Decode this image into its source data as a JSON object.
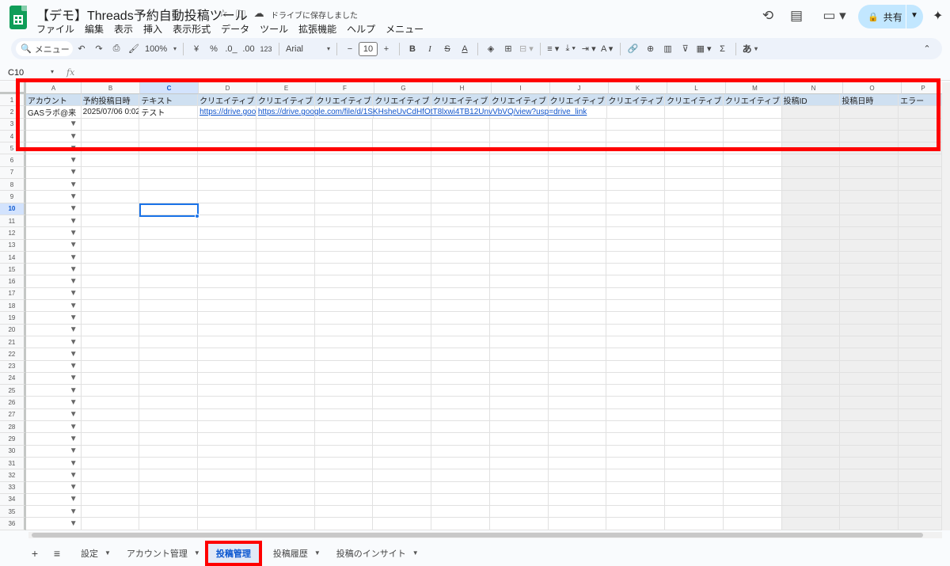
{
  "doc": {
    "title": "【デモ】Threads予約自動投稿ツール",
    "save_status": "ドライブに保存しました",
    "menu": [
      "ファイル",
      "編集",
      "表示",
      "挿入",
      "表示形式",
      "データ",
      "ツール",
      "拡張機能",
      "ヘルプ",
      "メニュー"
    ],
    "share_label": "共有"
  },
  "toolbar": {
    "search_label": "メニュー",
    "zoom": "100%",
    "currency": "¥",
    "percent": "%",
    "dec_decrease": ".0_",
    "dec_increase": ".00",
    "number_format": "123",
    "font": "Arial",
    "font_size": "10",
    "input_mode": "あ"
  },
  "formula_bar": {
    "cell_ref": "C10",
    "fx": "fx"
  },
  "grid": {
    "columns": [
      "A",
      "B",
      "C",
      "D",
      "E",
      "F",
      "G",
      "H",
      "I",
      "J",
      "K",
      "L",
      "M",
      "N",
      "O",
      "P"
    ],
    "headers": [
      "アカウント",
      "予約投稿日時",
      "テキスト",
      "クリエイティブ",
      "クリエイティブ",
      "クリエイティブ",
      "クリエイティブ",
      "クリエイティブ",
      "クリエイティブ",
      "クリエイティブ",
      "クリエイティブ",
      "クリエイティブ",
      "クリエイティブ",
      "投稿ID",
      "投稿日時",
      "エラー"
    ],
    "row2": {
      "account": "GASラボ@来",
      "datetime": "2025/07/06 0:02",
      "text": "テスト",
      "d_link": "https://drive.goog",
      "e_link": "https://drive.google.com/file/d/1SKHsheUvCdHfOtT8lxwi4TB12UnvVbVQ/view?usp=drive_link"
    },
    "row_count": 36,
    "selected_row": 10,
    "selected_col": "C"
  },
  "sheets": {
    "tabs": [
      "設定",
      "アカウント管理",
      "投稿管理",
      "投稿履歴",
      "投稿のインサイト"
    ],
    "active": "投稿管理"
  },
  "colors": {
    "accent": "#0b57d0",
    "highlight": "#ff0000",
    "header_row": "#cfe0f1",
    "share_bg": "#c2e7ff"
  }
}
